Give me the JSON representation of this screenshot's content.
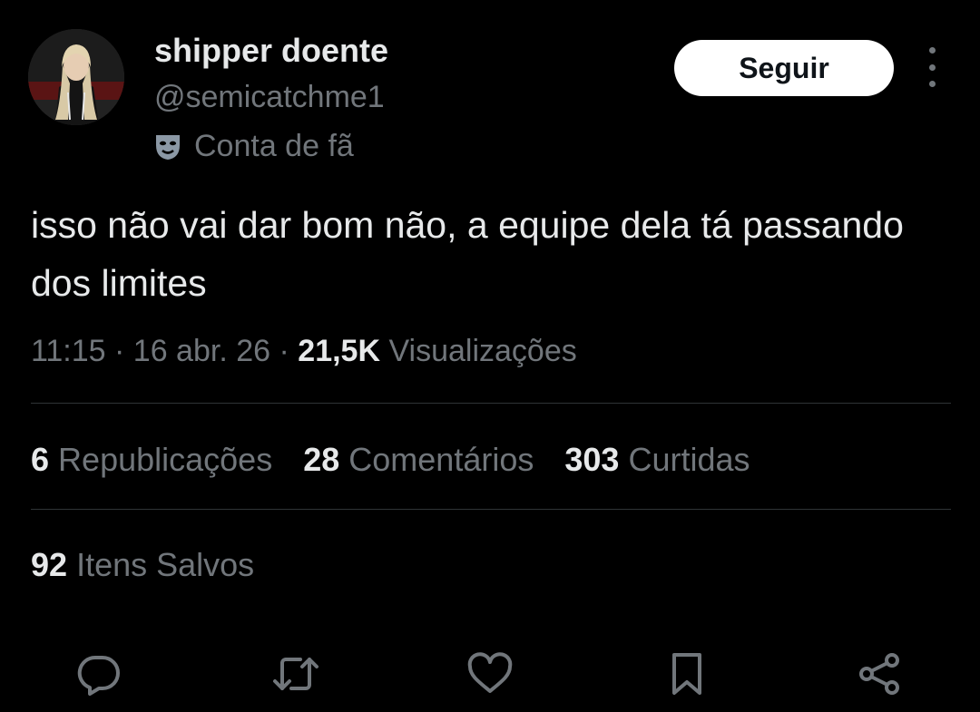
{
  "author": {
    "display_name": "shipper doente",
    "handle": "@semicatchme1",
    "label": "Conta de fã",
    "label_icon": "theater-mask-icon",
    "follow_label": "Seguir"
  },
  "tweet": {
    "text": "isso não vai dar bom não, a equipe dela tá passando dos limites",
    "time": "11:15",
    "date": "16 abr. 26",
    "views_count": "21,5K",
    "views_label": "Visualizações",
    "separator": "·"
  },
  "stats": {
    "reposts_count": "6",
    "reposts_label": "Republicações",
    "comments_count": "28",
    "comments_label": "Comentários",
    "likes_count": "303",
    "likes_label": "Curtidas",
    "saves_count": "92",
    "saves_label": "Itens Salvos"
  },
  "actions": [
    "reply-icon",
    "repost-icon",
    "like-icon",
    "bookmark-icon",
    "share-icon"
  ],
  "colors": {
    "background": "#000000",
    "primary_text": "#e7e9ea",
    "secondary_text": "#71767b",
    "divider": "#2f3336",
    "follow_button_bg": "#ffffff"
  }
}
